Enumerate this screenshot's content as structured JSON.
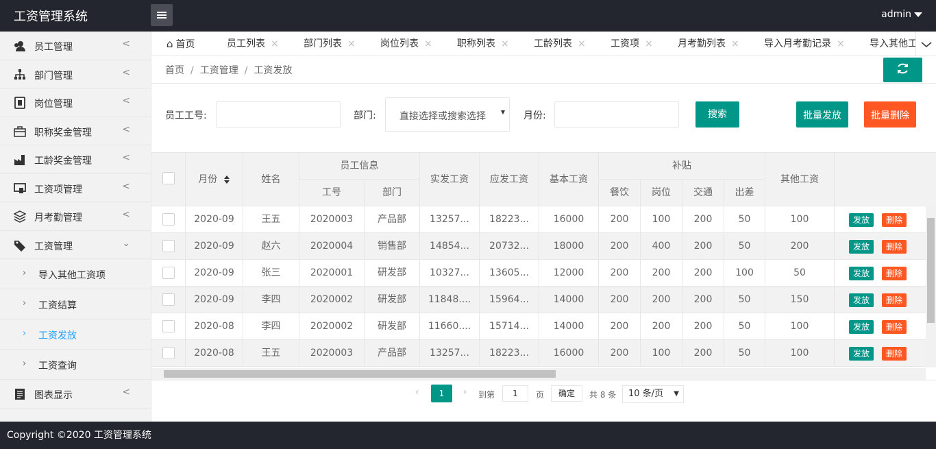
{
  "app": {
    "title": "工资管理系统",
    "user": "admin"
  },
  "sidebar": {
    "items": [
      {
        "label": "员工管理",
        "arrow": "<",
        "icon": "users-icon"
      },
      {
        "label": "部门管理",
        "arrow": "<",
        "icon": "org-chart-icon"
      },
      {
        "label": "岗位管理",
        "arrow": "<",
        "icon": "badge-icon"
      },
      {
        "label": "职称奖金管理",
        "arrow": "<",
        "icon": "briefcase-icon"
      },
      {
        "label": "工龄奖金管理",
        "arrow": "<",
        "icon": "factory-icon"
      },
      {
        "label": "工资项管理",
        "arrow": "<",
        "icon": "screen-icon"
      },
      {
        "label": "月考勤管理",
        "arrow": "<",
        "icon": "layers-icon"
      },
      {
        "label": "工资管理",
        "arrow": "v",
        "icon": "tag-icon"
      }
    ],
    "sub_items": [
      {
        "label": "导入其他工资项"
      },
      {
        "label": "工资结算"
      },
      {
        "label": "工资发放"
      },
      {
        "label": "工资查询"
      }
    ],
    "last_item": {
      "label": "图表显示",
      "arrow": "<",
      "icon": "report-icon"
    }
  },
  "tabs": {
    "home": "首页",
    "items": [
      "员工列表",
      "部门列表",
      "岗位列表",
      "职称列表",
      "工龄列表",
      "工资项",
      "月考勤列表",
      "导入月考勤记录",
      "导入其他工"
    ],
    "close": "×"
  },
  "breadcrumb": {
    "items": [
      "首页",
      "工资管理",
      "工资发放"
    ],
    "sep": "/"
  },
  "search": {
    "emp_no_label": "员工工号:",
    "emp_no_value": "",
    "dept_label": "部门:",
    "dept_placeholder": "直接选择或搜索选择",
    "month_label": "月份:",
    "month_value": "",
    "search_btn": "搜索",
    "batch_pay_btn": "批量发放",
    "batch_del_btn": "批量删除"
  },
  "table": {
    "headers": {
      "month": "月份",
      "name": "姓名",
      "emp_info": "员工信息",
      "emp_no": "工号",
      "dept": "部门",
      "actual": "实发工资",
      "payable": "应发工资",
      "base": "基本工资",
      "subsidy": "补贴",
      "meal": "餐饮",
      "post": "岗位",
      "traffic": "交通",
      "travel": "出差",
      "other": "其他工资"
    },
    "rows": [
      {
        "month": "2020-09",
        "name": "王五",
        "no": "2020003",
        "dept": "产品部",
        "actual": "13257...",
        "payable": "18223...",
        "base": "16000",
        "meal": "200",
        "post": "100",
        "traffic": "200",
        "travel": "50",
        "other": "100"
      },
      {
        "month": "2020-09",
        "name": "赵六",
        "no": "2020004",
        "dept": "销售部",
        "actual": "14854...",
        "payable": "20732...",
        "base": "18000",
        "meal": "200",
        "post": "400",
        "traffic": "200",
        "travel": "50",
        "other": "200"
      },
      {
        "month": "2020-09",
        "name": "张三",
        "no": "2020001",
        "dept": "研发部",
        "actual": "10327...",
        "payable": "13605...",
        "base": "12000",
        "meal": "200",
        "post": "200",
        "traffic": "200",
        "travel": "100",
        "other": "50"
      },
      {
        "month": "2020-09",
        "name": "李四",
        "no": "2020002",
        "dept": "研发部",
        "actual": "11848....",
        "payable": "15964...",
        "base": "14000",
        "meal": "200",
        "post": "200",
        "traffic": "200",
        "travel": "50",
        "other": "150"
      },
      {
        "month": "2020-08",
        "name": "李四",
        "no": "2020002",
        "dept": "研发部",
        "actual": "11660....",
        "payable": "15714...",
        "base": "14000",
        "meal": "200",
        "post": "200",
        "traffic": "200",
        "travel": "50",
        "other": "100"
      },
      {
        "month": "2020-08",
        "name": "王五",
        "no": "2020003",
        "dept": "产品部",
        "actual": "13257...",
        "payable": "18223...",
        "base": "16000",
        "meal": "200",
        "post": "100",
        "traffic": "200",
        "travel": "50",
        "other": "100"
      }
    ],
    "pay_btn": "发放",
    "del_btn": "删除"
  },
  "pager": {
    "current": "1",
    "goto_label": "到第",
    "goto_value": "1",
    "page_label": "页",
    "confirm": "确定",
    "total": "共 8 条",
    "page_size": "10 条/页"
  },
  "footer": {
    "text": "Copyright ©2020 工资管理系统"
  }
}
